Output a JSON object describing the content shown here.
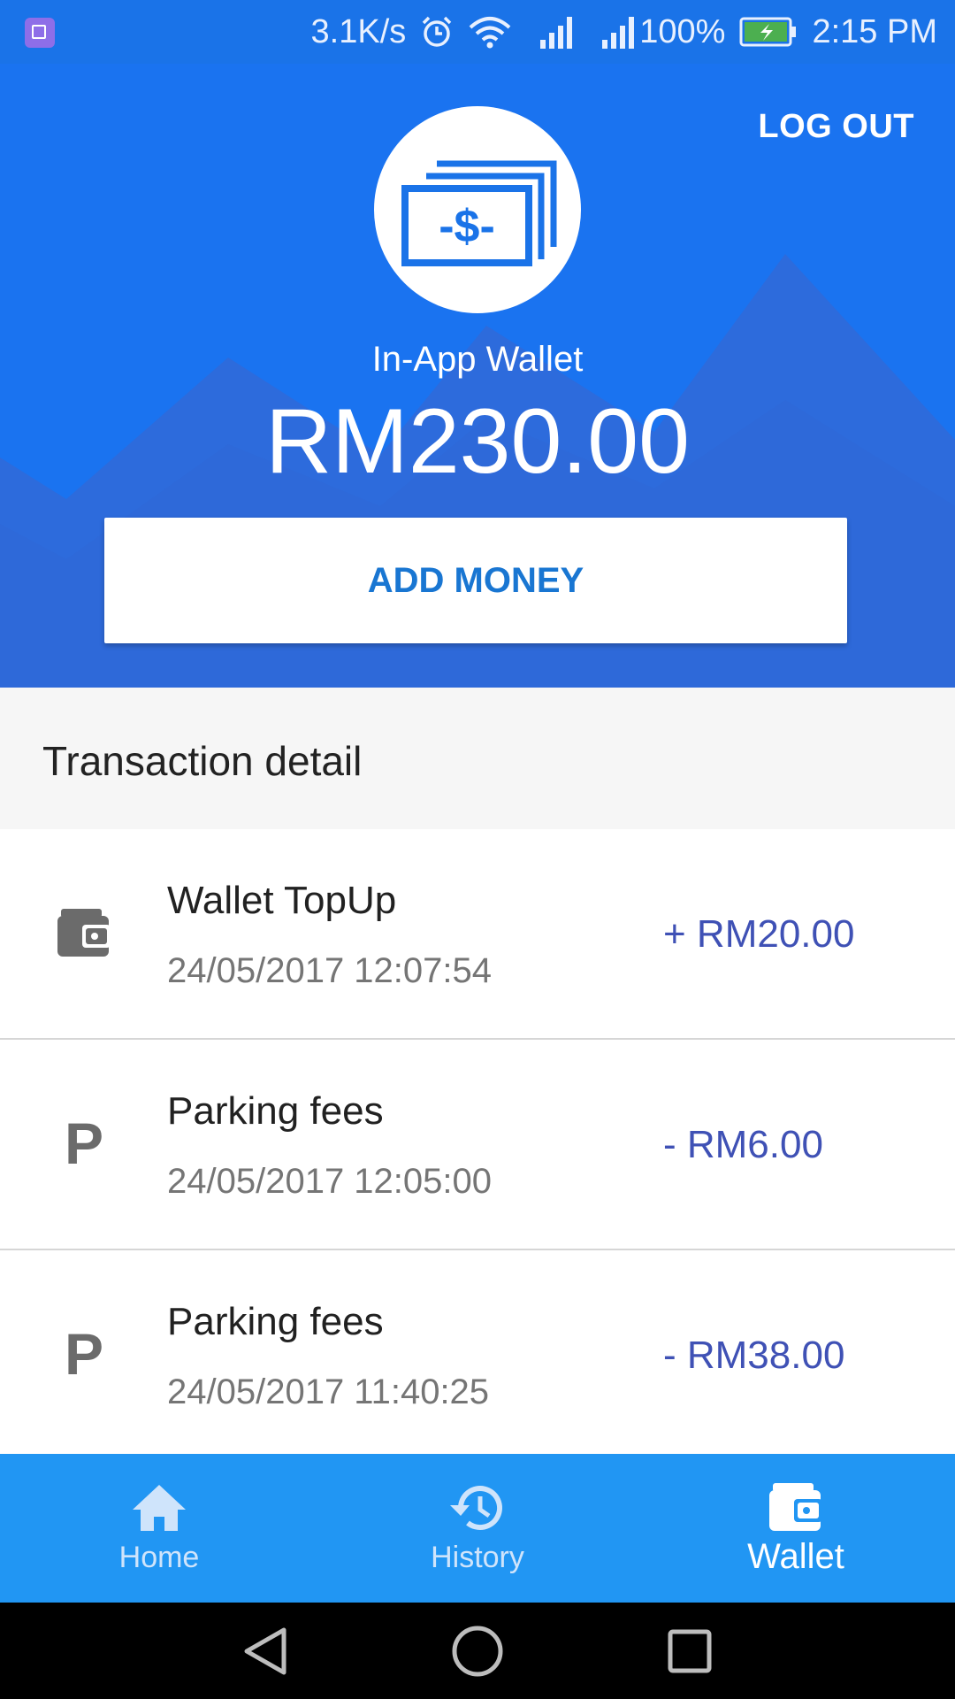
{
  "status_bar": {
    "speed": "3.1K/s",
    "battery": "100%",
    "time": "2:15 PM",
    "icons": [
      "app-notification-icon",
      "alarm-icon",
      "wifi-icon",
      "signal-icon",
      "signal-icon",
      "battery-charging-icon"
    ]
  },
  "header": {
    "logout_label": "LOG OUT",
    "wallet_title": "In-App Wallet",
    "balance": "RM230.00",
    "add_money_label": "ADD MONEY",
    "logo_icon": "money-stack-icon"
  },
  "transactions_section": {
    "title": "Transaction detail",
    "items": [
      {
        "icon": "wallet-icon",
        "title": "Wallet TopUp",
        "date": "24/05/2017 12:07:54",
        "amount": "+ RM20.00"
      },
      {
        "icon": "parking-icon",
        "title": "Parking fees",
        "date": "24/05/2017 12:05:00",
        "amount": "- RM6.00"
      },
      {
        "icon": "parking-icon",
        "title": "Parking fees",
        "date": "24/05/2017 11:40:25",
        "amount": "- RM38.00"
      }
    ]
  },
  "bottom_nav": {
    "items": [
      {
        "label": "Home",
        "icon": "home-icon",
        "active": false
      },
      {
        "label": "History",
        "icon": "history-icon",
        "active": false
      },
      {
        "label": "Wallet",
        "icon": "wallet-icon",
        "active": true
      }
    ]
  },
  "colors": {
    "header_blue": "#1a73f0",
    "nav_blue": "#2196f3",
    "amount_indigo": "#3f51b5",
    "button_text_blue": "#1976d2"
  }
}
